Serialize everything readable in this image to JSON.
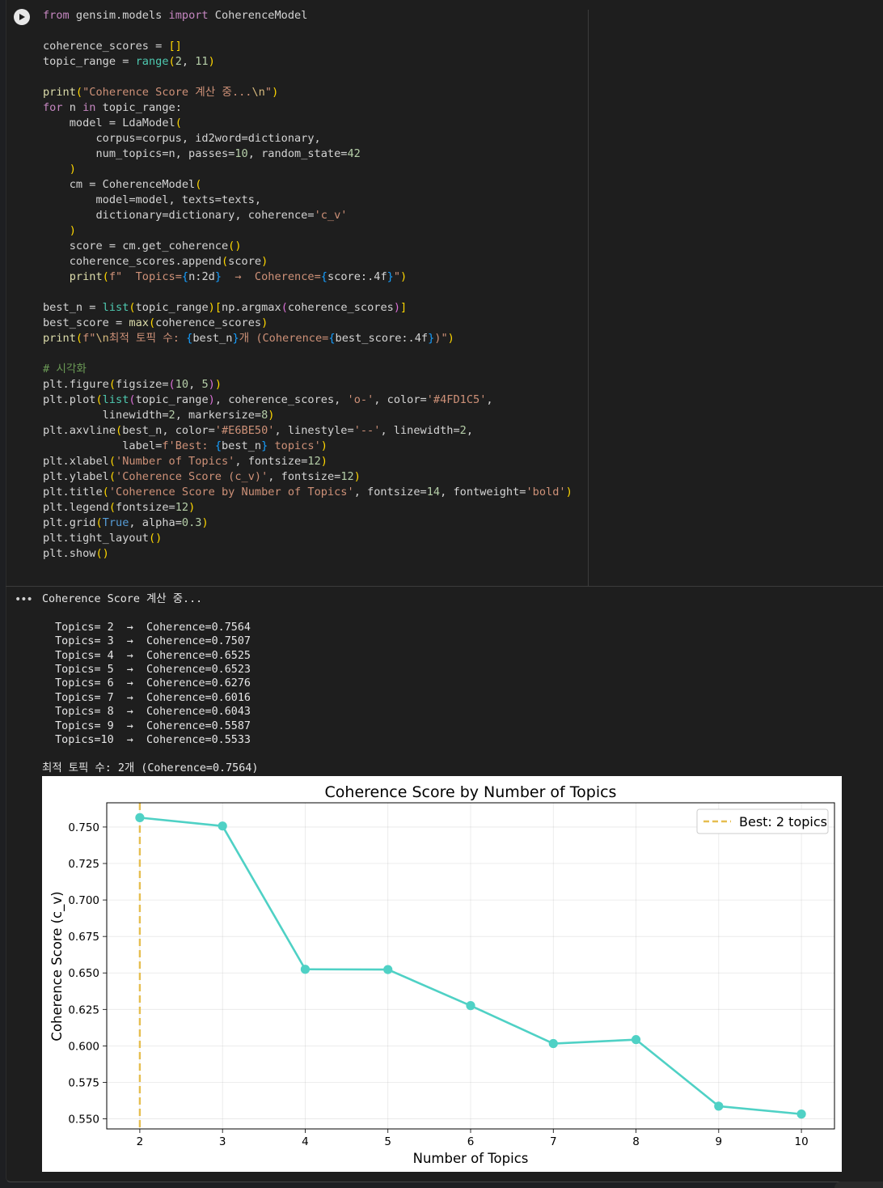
{
  "code_cell": {
    "lines": [
      [
        [
          "kw",
          "from"
        ],
        [
          "t",
          " gensim.models "
        ],
        [
          "kw",
          "import"
        ],
        [
          "t",
          " CoherenceModel"
        ]
      ],
      [],
      [
        [
          "t",
          "coherence_scores = "
        ],
        [
          "p1",
          "[]"
        ]
      ],
      [
        [
          "t",
          "topic_range = "
        ],
        [
          "bi",
          "range"
        ],
        [
          "p1",
          "("
        ],
        [
          "num",
          "2"
        ],
        [
          "t",
          ", "
        ],
        [
          "num",
          "11"
        ],
        [
          "p1",
          ")"
        ]
      ],
      [],
      [
        [
          "fn",
          "print"
        ],
        [
          "p1",
          "("
        ],
        [
          "str",
          "\"Coherence Score 계산 중..."
        ],
        [
          "esc",
          "\\n"
        ],
        [
          "str",
          "\""
        ],
        [
          "p1",
          ")"
        ]
      ],
      [
        [
          "kw",
          "for"
        ],
        [
          "t",
          " n "
        ],
        [
          "kw",
          "in"
        ],
        [
          "t",
          " topic_range:"
        ]
      ],
      [
        [
          "t",
          "    model = LdaModel"
        ],
        [
          "p1",
          "("
        ]
      ],
      [
        [
          "t",
          "        corpus=corpus, id2word=dictionary,"
        ]
      ],
      [
        [
          "t",
          "        num_topics=n, passes="
        ],
        [
          "num",
          "10"
        ],
        [
          "t",
          ", random_state="
        ],
        [
          "num",
          "42"
        ]
      ],
      [
        [
          "t",
          "    "
        ],
        [
          "p1",
          ")"
        ]
      ],
      [
        [
          "t",
          "    cm = CoherenceModel"
        ],
        [
          "p1",
          "("
        ]
      ],
      [
        [
          "t",
          "        model=model, texts=texts,"
        ]
      ],
      [
        [
          "t",
          "        dictionary=dictionary, coherence="
        ],
        [
          "str",
          "'c_v'"
        ]
      ],
      [
        [
          "t",
          "    "
        ],
        [
          "p1",
          ")"
        ]
      ],
      [
        [
          "t",
          "    score = cm.get_coherence"
        ],
        [
          "p1",
          "()"
        ]
      ],
      [
        [
          "t",
          "    coherence_scores.append"
        ],
        [
          "p1",
          "("
        ],
        [
          "t",
          "score"
        ],
        [
          "p1",
          ")"
        ]
      ],
      [
        [
          "t",
          "    "
        ],
        [
          "fn",
          "print"
        ],
        [
          "p1",
          "("
        ],
        [
          "str",
          "f\"  Topics="
        ],
        [
          "p3",
          "{"
        ],
        [
          "t",
          "n:2d"
        ],
        [
          "p3",
          "}"
        ],
        [
          "str",
          "  →  Coherence="
        ],
        [
          "p3",
          "{"
        ],
        [
          "t",
          "score:.4f"
        ],
        [
          "p3",
          "}"
        ],
        [
          "str",
          "\""
        ],
        [
          "p1",
          ")"
        ]
      ],
      [],
      [
        [
          "t",
          "best_n = "
        ],
        [
          "bi",
          "list"
        ],
        [
          "p1",
          "("
        ],
        [
          "t",
          "topic_range"
        ],
        [
          "p1",
          ")"
        ],
        [
          "p1",
          "["
        ],
        [
          "t",
          "np.argmax"
        ],
        [
          "p2",
          "("
        ],
        [
          "t",
          "coherence_scores"
        ],
        [
          "p2",
          ")"
        ],
        [
          "p1",
          "]"
        ]
      ],
      [
        [
          "t",
          "best_score = "
        ],
        [
          "fn",
          "max"
        ],
        [
          "p1",
          "("
        ],
        [
          "t",
          "coherence_scores"
        ],
        [
          "p1",
          ")"
        ]
      ],
      [
        [
          "fn",
          "print"
        ],
        [
          "p1",
          "("
        ],
        [
          "str",
          "f\""
        ],
        [
          "esc",
          "\\n"
        ],
        [
          "str",
          "최적 토픽 수: "
        ],
        [
          "p3",
          "{"
        ],
        [
          "t",
          "best_n"
        ],
        [
          "p3",
          "}"
        ],
        [
          "str",
          "개 (Coherence="
        ],
        [
          "p3",
          "{"
        ],
        [
          "t",
          "best_score:.4f"
        ],
        [
          "p3",
          "}"
        ],
        [
          "str",
          ")\""
        ],
        [
          "p1",
          ")"
        ]
      ],
      [],
      [
        [
          "cm",
          "# 시각화"
        ]
      ],
      [
        [
          "t",
          "plt.figure"
        ],
        [
          "p1",
          "("
        ],
        [
          "t",
          "figsize="
        ],
        [
          "p2",
          "("
        ],
        [
          "num",
          "10"
        ],
        [
          "t",
          ", "
        ],
        [
          "num",
          "5"
        ],
        [
          "p2",
          ")"
        ],
        [
          "p1",
          ")"
        ]
      ],
      [
        [
          "t",
          "plt.plot"
        ],
        [
          "p1",
          "("
        ],
        [
          "bi",
          "list"
        ],
        [
          "p2",
          "("
        ],
        [
          "t",
          "topic_range"
        ],
        [
          "p2",
          ")"
        ],
        [
          "t",
          ", coherence_scores, "
        ],
        [
          "str",
          "'o-'"
        ],
        [
          "t",
          ", color="
        ],
        [
          "str",
          "'#4FD1C5'"
        ],
        [
          "t",
          ","
        ]
      ],
      [
        [
          "t",
          "         linewidth="
        ],
        [
          "num",
          "2"
        ],
        [
          "t",
          ", markersize="
        ],
        [
          "num",
          "8"
        ],
        [
          "p1",
          ")"
        ]
      ],
      [
        [
          "t",
          "plt.axvline"
        ],
        [
          "p1",
          "("
        ],
        [
          "t",
          "best_n, color="
        ],
        [
          "str",
          "'#E6BE50'"
        ],
        [
          "t",
          ", linestyle="
        ],
        [
          "str",
          "'--'"
        ],
        [
          "t",
          ", linewidth="
        ],
        [
          "num",
          "2"
        ],
        [
          "t",
          ","
        ]
      ],
      [
        [
          "t",
          "            label="
        ],
        [
          "str",
          "f'Best: "
        ],
        [
          "p3",
          "{"
        ],
        [
          "t",
          "best_n"
        ],
        [
          "p3",
          "}"
        ],
        [
          "str",
          " topics'"
        ],
        [
          "p1",
          ")"
        ]
      ],
      [
        [
          "t",
          "plt.xlabel"
        ],
        [
          "p1",
          "("
        ],
        [
          "str",
          "'Number of Topics'"
        ],
        [
          "t",
          ", fontsize="
        ],
        [
          "num",
          "12"
        ],
        [
          "p1",
          ")"
        ]
      ],
      [
        [
          "t",
          "plt.ylabel"
        ],
        [
          "p1",
          "("
        ],
        [
          "str",
          "'Coherence Score (c_v)'"
        ],
        [
          "t",
          ", fontsize="
        ],
        [
          "num",
          "12"
        ],
        [
          "p1",
          ")"
        ]
      ],
      [
        [
          "t",
          "plt.title"
        ],
        [
          "p1",
          "("
        ],
        [
          "str",
          "'Coherence Score by Number of Topics'"
        ],
        [
          "t",
          ", fontsize="
        ],
        [
          "num",
          "14"
        ],
        [
          "t",
          ", fontweight="
        ],
        [
          "str",
          "'bold'"
        ],
        [
          "p1",
          ")"
        ]
      ],
      [
        [
          "t",
          "plt.legend"
        ],
        [
          "p1",
          "("
        ],
        [
          "t",
          "fontsize="
        ],
        [
          "num",
          "12"
        ],
        [
          "p1",
          ")"
        ]
      ],
      [
        [
          "t",
          "plt.grid"
        ],
        [
          "p1",
          "("
        ],
        [
          "bool",
          "True"
        ],
        [
          "t",
          ", alpha="
        ],
        [
          "num",
          "0.3"
        ],
        [
          "p1",
          ")"
        ]
      ],
      [
        [
          "t",
          "plt.tight_layout"
        ],
        [
          "p1",
          "()"
        ]
      ],
      [
        [
          "t",
          "plt.show"
        ],
        [
          "p1",
          "()"
        ]
      ]
    ]
  },
  "output": {
    "menu_label": "•••",
    "lines": [
      "Coherence Score 계산 중...",
      "",
      "  Topics= 2  →  Coherence=0.7564",
      "  Topics= 3  →  Coherence=0.7507",
      "  Topics= 4  →  Coherence=0.6525",
      "  Topics= 5  →  Coherence=0.6523",
      "  Topics= 6  →  Coherence=0.6276",
      "  Topics= 7  →  Coherence=0.6016",
      "  Topics= 8  →  Coherence=0.6043",
      "  Topics= 9  →  Coherence=0.5587",
      "  Topics=10  →  Coherence=0.5533",
      "",
      "최적 토픽 수: 2개 (Coherence=0.7564)"
    ]
  },
  "chart_data": {
    "type": "line",
    "title": "Coherence Score by Number of Topics",
    "xlabel": "Number of Topics",
    "ylabel": "Coherence Score (c_v)",
    "x": [
      2,
      3,
      4,
      5,
      6,
      7,
      8,
      9,
      10
    ],
    "series": [
      {
        "values": [
          0.7564,
          0.7507,
          0.6525,
          0.6523,
          0.6276,
          0.6016,
          0.6043,
          0.5587,
          0.5533
        ],
        "color": "#4FD1C5"
      }
    ],
    "vline": {
      "x": 2,
      "color": "#E6BE50",
      "label": "Best: 2 topics"
    },
    "xticks": [
      2,
      3,
      4,
      5,
      6,
      7,
      8,
      9,
      10
    ],
    "yticks": [
      "0.550",
      "0.575",
      "0.600",
      "0.625",
      "0.650",
      "0.675",
      "0.700",
      "0.725",
      "0.750"
    ],
    "xlim": [
      1.6,
      10.4
    ],
    "ylim": [
      0.5431,
      0.7666
    ],
    "grid": true,
    "legend_position": "top-right"
  }
}
